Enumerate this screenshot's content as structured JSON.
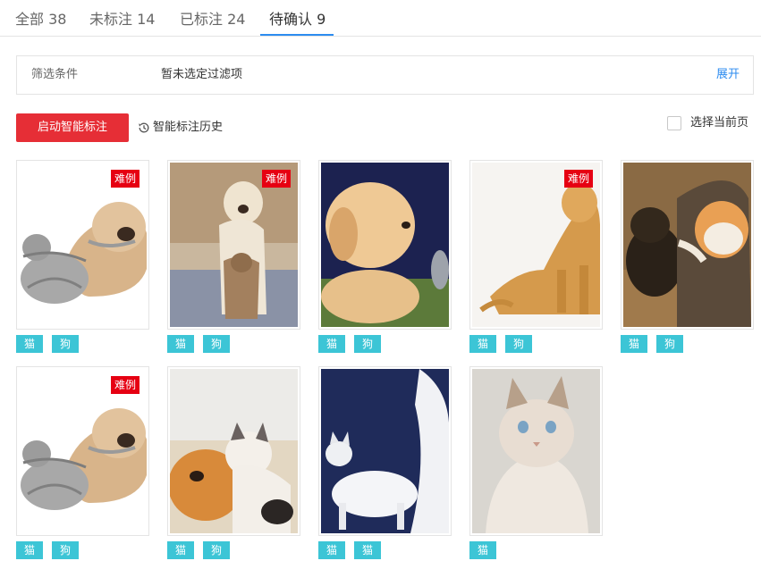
{
  "tabs": [
    {
      "label": "全部 38"
    },
    {
      "label": "未标注 14"
    },
    {
      "label": "已标注 24"
    },
    {
      "label": "待确认 9"
    }
  ],
  "active_tab": 3,
  "filter": {
    "label": "筛选条件",
    "value": "暂未选定过滤项",
    "expand": "展开"
  },
  "toolbar": {
    "smart_label": "启动智能标注",
    "history_label": "智能标注历史",
    "select_page_label": "选择当前页"
  },
  "badge_text": "难例",
  "colors": {
    "accent_blue": "#2d8cf0",
    "button_red": "#e62e36",
    "badge_red": "#e60012",
    "tag_teal": "#3cc5d6"
  },
  "images": [
    {
      "subject": "dog-and-cat",
      "hard": true,
      "tags": [
        "猫",
        "狗"
      ]
    },
    {
      "subject": "dog-and-cat",
      "hard": true,
      "tags": [
        "猫",
        "狗"
      ]
    },
    {
      "subject": "puppy-and-kitten",
      "hard": false,
      "tags": [
        "猫",
        "狗"
      ]
    },
    {
      "subject": "dog",
      "hard": true,
      "tags": [
        "猫",
        "狗"
      ]
    },
    {
      "subject": "puppy-and-cat",
      "hard": false,
      "tags": [
        "猫",
        "狗"
      ]
    },
    {
      "subject": "dog-and-cat",
      "hard": true,
      "tags": [
        "猫",
        "狗"
      ]
    },
    {
      "subject": "kitten-and-puppy",
      "hard": false,
      "tags": [
        "猫",
        "狗"
      ]
    },
    {
      "subject": "white-cats",
      "hard": false,
      "tags": [
        "猫",
        "猫"
      ]
    },
    {
      "subject": "ragdoll-cat",
      "hard": false,
      "tags": [
        "猫"
      ]
    }
  ]
}
